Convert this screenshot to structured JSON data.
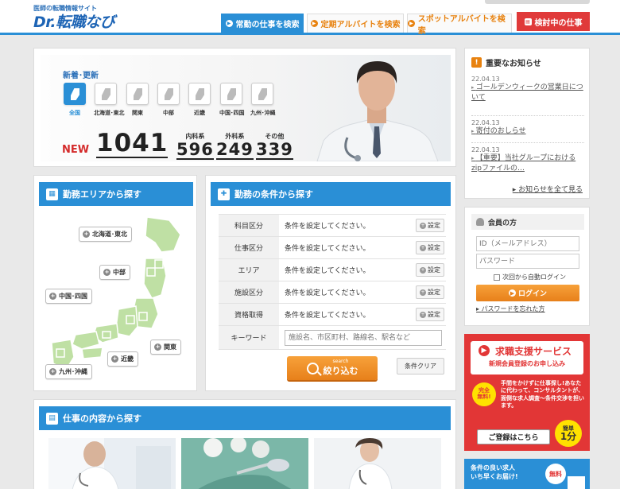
{
  "header": {
    "logo_sub": "医師の転職情報サイト",
    "logo": "Dr.転職なび",
    "tabs": [
      {
        "label": "常勤の仕事を検索"
      },
      {
        "label": "定期アルバイトを検索"
      },
      {
        "label": "スポットアルバイトを検索"
      },
      {
        "label": "検討中の仕事"
      }
    ]
  },
  "hero": {
    "title": "新着･更新",
    "regions": [
      "全国",
      "北海道･東北",
      "関東",
      "中部",
      "近畿",
      "中国･四国",
      "九州･沖縄"
    ],
    "new_label": "NEW",
    "total": "1041",
    "counts": [
      {
        "label": "内科系",
        "value": "596"
      },
      {
        "label": "外科系",
        "value": "249"
      },
      {
        "label": "その他",
        "value": "339"
      }
    ]
  },
  "notices": {
    "title": "重要なお知らせ",
    "items": [
      {
        "date": "22.04.13",
        "text": "ゴールデンウィークの営業日について"
      },
      {
        "date": "22.04.13",
        "text": "寄付のおしらせ"
      },
      {
        "date": "22.04.13",
        "text": "【重要】当社グループにおけるzipファイルの…"
      }
    ],
    "all_link": "お知らせを全て見る"
  },
  "area": {
    "title": "勤務エリアから探す",
    "buttons": [
      "北海道･東北",
      "中部",
      "中国･四国",
      "近畿",
      "関東",
      "九州･沖縄"
    ]
  },
  "conditions": {
    "title": "勤務の条件から探す",
    "rows": [
      {
        "key": "科目区分",
        "value": "条件を設定してください。"
      },
      {
        "key": "仕事区分",
        "value": "条件を設定してください。"
      },
      {
        "key": "エリア",
        "value": "条件を設定してください。"
      },
      {
        "key": "施設区分",
        "value": "条件を設定してください。"
      },
      {
        "key": "資格取得",
        "value": "条件を設定してください。"
      }
    ],
    "set_label": "設定",
    "keyword_label": "キーワード",
    "keyword_placeholder": "施設名、市区町村、路線名、駅名など",
    "search_small": "search",
    "search_label": "絞り込む",
    "clear_label": "条件クリア"
  },
  "member": {
    "title": "会員の方",
    "id_placeholder": "ID（メールアドレス）",
    "password_placeholder": "パスワード",
    "auto_login": "次回から自動ログイン",
    "login": "ログイン",
    "forgot": "パスワードを忘れた方"
  },
  "support": {
    "title": "求職支援サービス",
    "subtitle": "新規会員登録のお申し込み",
    "free_line1": "完全",
    "free_line2": "無料!",
    "description": "手間をかけずに仕事探し!あなたに代わって、コンサルタントが、面倒な求人調査～条件交渉を担います。",
    "register": "ご登録はこちら",
    "easy_label": "簡単",
    "easy_value": "1分"
  },
  "banner2": {
    "line1": "条件の良い求人",
    "line2": "いち早くお届け!",
    "badge": "無料"
  },
  "jobs": {
    "title": "仕事の内容から探す"
  },
  "colors": {
    "primary_blue": "#2a8fd6",
    "accent_orange": "#e8820f",
    "alert_red": "#e23636"
  }
}
